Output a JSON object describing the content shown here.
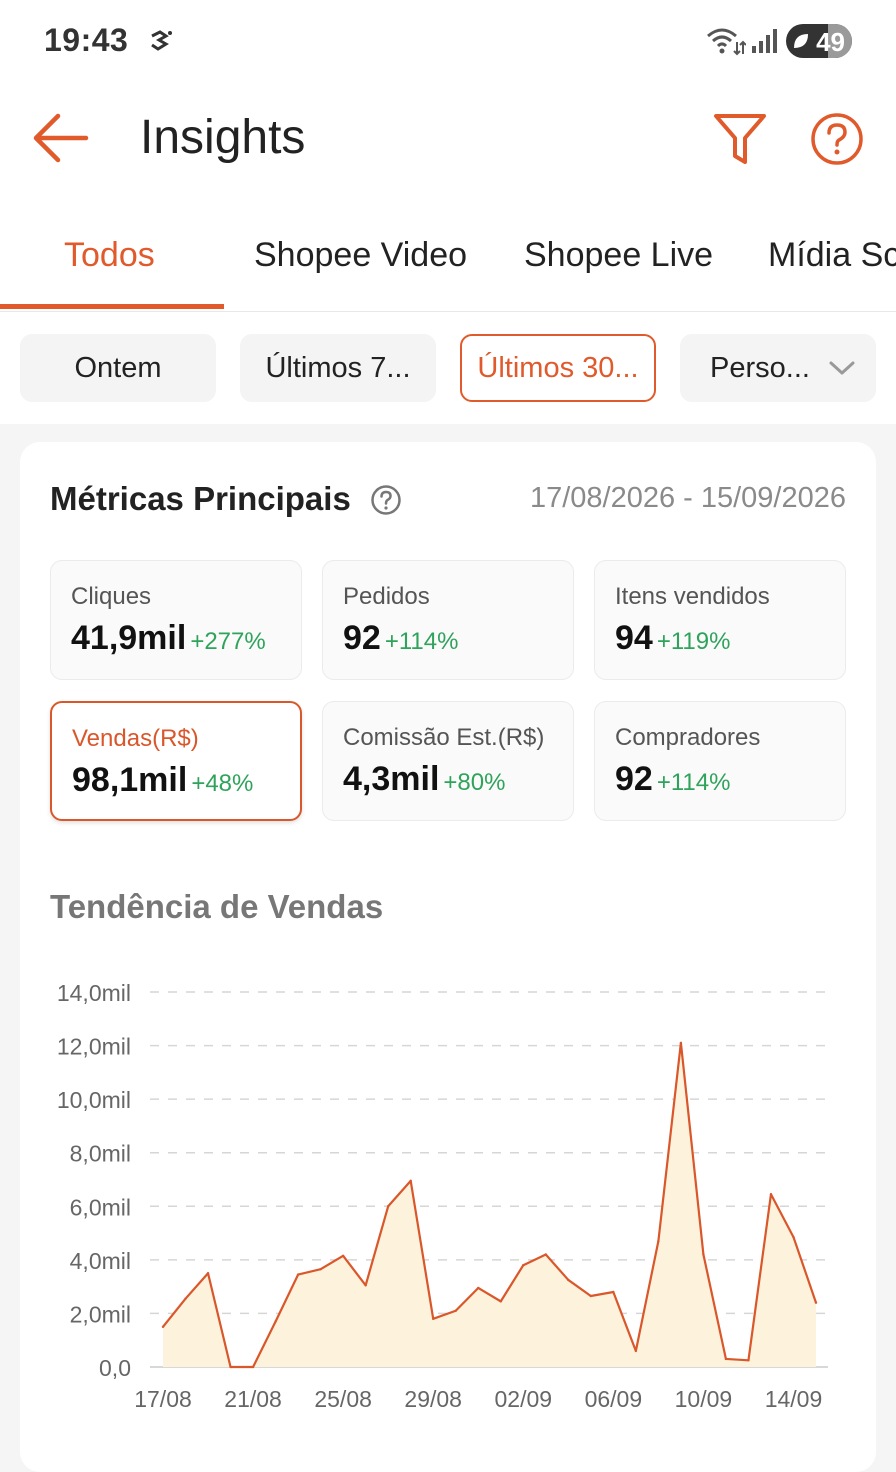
{
  "status_bar": {
    "time": "19:43",
    "battery": "49",
    "battery_level": 0.49
  },
  "app_bar": {
    "title": "Insights"
  },
  "tabs": [
    {
      "label": "Todos",
      "active": true
    },
    {
      "label": "Shopee Video",
      "active": false
    },
    {
      "label": "Shopee Live",
      "active": false
    },
    {
      "label": "Mídia Sc",
      "active": false
    }
  ],
  "period_chips": [
    {
      "label": "Ontem",
      "active": false
    },
    {
      "label": "Últimos 7...",
      "active": false
    },
    {
      "label": "Últimos 30...",
      "active": true
    },
    {
      "label": "Perso...",
      "active": false,
      "has_dropdown": true
    }
  ],
  "metrics_section": {
    "title": "Métricas Principais",
    "date_range": "17/08/2026 - 15/09/2026",
    "metrics": [
      {
        "label": "Cliques",
        "value": "41,9mil",
        "change": "+277%",
        "selected": false
      },
      {
        "label": "Pedidos",
        "value": "92",
        "change": "+114%",
        "selected": false
      },
      {
        "label": "Itens vendidos",
        "value": "94",
        "change": "+119%",
        "selected": false
      },
      {
        "label": "Vendas(R$)",
        "value": "98,1mil",
        "change": "+48%",
        "selected": true
      },
      {
        "label": "Comissão Est.(R$)",
        "value": "4,3mil",
        "change": "+80%",
        "selected": false
      },
      {
        "label": "Compradores",
        "value": "92",
        "change": "+114%",
        "selected": false
      }
    ]
  },
  "trend_section": {
    "title": "Tendência de Vendas"
  },
  "colors": {
    "accent": "#e05a2b",
    "positive": "#2fa35b",
    "line": "#d9572b",
    "area": "#fdf3dc"
  },
  "chart_data": {
    "type": "area",
    "title": "Tendência de Vendas",
    "xlabel": "",
    "ylabel": "",
    "ylim": [
      0,
      14000
    ],
    "y_ticks": [
      "0,0",
      "2,0mil",
      "4,0mil",
      "6,0mil",
      "8,0mil",
      "10,0mil",
      "12,0mil",
      "14,0mil"
    ],
    "x_ticks": [
      "17/08",
      "21/08",
      "25/08",
      "29/08",
      "02/09",
      "06/09",
      "10/09",
      "14/09"
    ],
    "grid": true,
    "x": [
      "17/08",
      "18/08",
      "19/08",
      "20/08",
      "21/08",
      "22/08",
      "23/08",
      "24/08",
      "25/08",
      "26/08",
      "27/08",
      "28/08",
      "29/08",
      "30/08",
      "31/08",
      "01/09",
      "02/09",
      "03/09",
      "04/09",
      "05/09",
      "06/09",
      "07/09",
      "08/09",
      "09/09",
      "10/09",
      "11/09",
      "12/09",
      "13/09",
      "14/09",
      "15/09"
    ],
    "values": [
      1500,
      2550,
      3500,
      0,
      0,
      1700,
      3450,
      3650,
      4150,
      3050,
      6000,
      6950,
      1800,
      2100,
      2950,
      2450,
      3800,
      4200,
      3250,
      2650,
      2800,
      600,
      4700,
      12100,
      4200,
      300,
      250,
      6450,
      4850,
      2400
    ]
  }
}
